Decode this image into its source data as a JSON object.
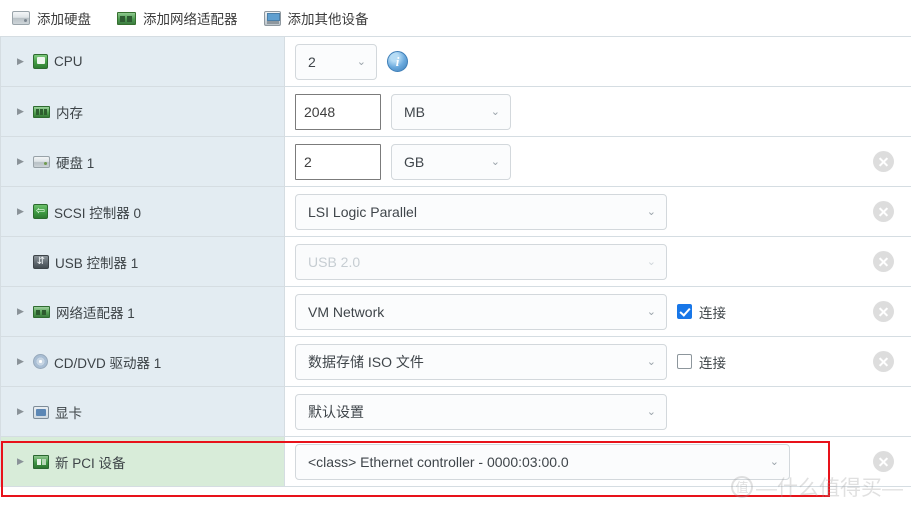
{
  "toolbar": {
    "items": [
      {
        "label": "添加硬盘",
        "icon": "hard-disk-icon"
      },
      {
        "label": "添加网络适配器",
        "icon": "network-adapter-icon"
      },
      {
        "label": "添加其他设备",
        "icon": "other-device-icon"
      }
    ]
  },
  "rows": [
    {
      "name": "CPU",
      "icon": "cpu-icon",
      "expandable": true,
      "control": "cpu",
      "value": "2",
      "info": "i",
      "deletable": false
    },
    {
      "name": "内存",
      "icon": "memory-icon",
      "expandable": true,
      "control": "input-unit",
      "value": "2048",
      "unit": "MB",
      "deletable": false
    },
    {
      "name": "硬盘 1",
      "icon": "hard-disk-icon",
      "expandable": true,
      "control": "input-unit",
      "value": "2",
      "unit": "GB",
      "deletable": true
    },
    {
      "name": "SCSI 控制器 0",
      "icon": "scsi-controller-icon",
      "expandable": true,
      "control": "select",
      "value": "LSI Logic Parallel",
      "deletable": true
    },
    {
      "name": "USB 控制器 1",
      "icon": "usb-controller-icon",
      "expandable": false,
      "control": "select-disabled",
      "value": "USB 2.0",
      "deletable": true
    },
    {
      "name": "网络适配器 1",
      "icon": "network-adapter-icon",
      "expandable": true,
      "control": "select-check",
      "value": "VM Network",
      "checkbox_label": "连接",
      "checked": true,
      "deletable": true
    },
    {
      "name": "CD/DVD 驱动器 1",
      "icon": "cd-dvd-icon",
      "expandable": true,
      "control": "select-check",
      "value": "数据存储 ISO 文件",
      "checkbox_label": "连接",
      "checked": false,
      "deletable": true
    },
    {
      "name": "显卡",
      "icon": "video-card-icon",
      "expandable": true,
      "control": "select",
      "value": "默认设置",
      "deletable": false
    },
    {
      "name": "新 PCI 设备",
      "icon": "pci-device-icon",
      "expandable": true,
      "control": "select-wide",
      "value": "<class> Ethernet controller - 0000:03:00.0",
      "deletable": true,
      "highlighted": true
    }
  ],
  "icons": {
    "caret": "▶",
    "chevron": "⌄",
    "scsi_glyph": "⇦",
    "usb_glyph": "⇵"
  },
  "watermark": {
    "logo": "值",
    "text": "—什么值得买—"
  },
  "colors": {
    "row_name_bg": "#e3ecf2",
    "row_highlight_bg": "#d8ecd9",
    "highlight_border": "#e8121a",
    "checkbox_checked": "#1877e8",
    "info_icon": "#6aa9dd"
  }
}
